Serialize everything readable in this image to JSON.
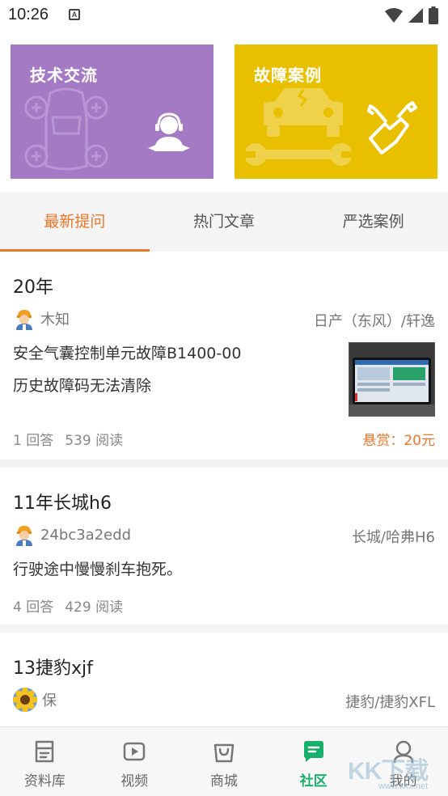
{
  "status_bar": {
    "time": "10:26",
    "notification_letter": "A"
  },
  "banners": {
    "tech": {
      "title": "技术交流",
      "color": "#a57ac4"
    },
    "fault": {
      "title": "故障案例",
      "color": "#e8c000"
    }
  },
  "tabs": [
    {
      "label": "最新提问",
      "active": true
    },
    {
      "label": "热门文章",
      "active": false
    },
    {
      "label": "严选案例",
      "active": false
    }
  ],
  "accent_color": "#ee7526",
  "posts": [
    {
      "title": "20年",
      "author": "木知",
      "car": "日产（东风）/轩逸",
      "body_line1": "安全气囊控制单元故障B1400-00",
      "body_line2": "历史故障码无法清除",
      "answers": "1 回答",
      "reads": "539 阅读",
      "reward": "悬赏：20元"
    },
    {
      "title": "11年长城h6",
      "author": "24bc3a2edd",
      "car": "长城/哈弗H6",
      "body_line1": "行驶途中慢慢刹车抱死。",
      "answers": "4 回答",
      "reads": "429 阅读"
    },
    {
      "title": "13捷豹xjf",
      "author": "保",
      "car": "捷豹/捷豹XFL"
    }
  ],
  "bottom_nav": [
    {
      "label": "资料库",
      "icon": "library-icon"
    },
    {
      "label": "视频",
      "icon": "video-icon"
    },
    {
      "label": "商城",
      "icon": "shop-bag-icon"
    },
    {
      "label": "社区",
      "icon": "community-chat-icon",
      "active": true
    },
    {
      "label": "我的",
      "icon": "profile-icon"
    }
  ],
  "nav_active_color": "#17b06b",
  "watermark": {
    "main": "KK下载",
    "sub": "www.kkx.net"
  }
}
